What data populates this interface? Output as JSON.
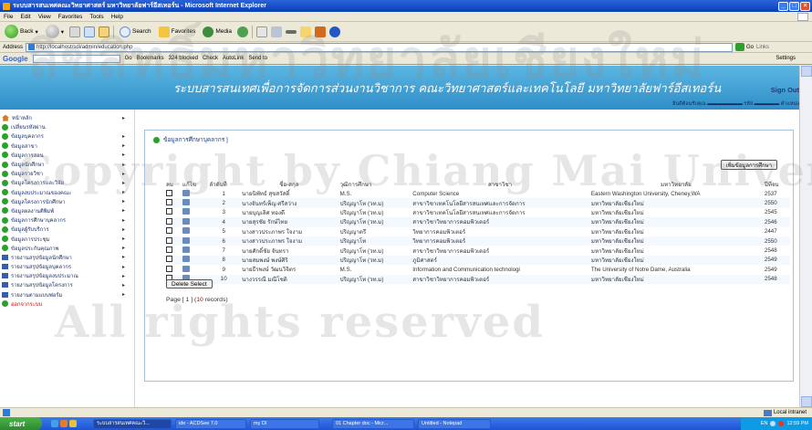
{
  "window": {
    "title": "ระบบสารสนเทศคณะวิทยาศาสตร์ มหาวิทยาลัยฟาร์อีสเทอร์น - Microsoft Internet Explorer"
  },
  "menu": [
    "File",
    "Edit",
    "View",
    "Favorites",
    "Tools",
    "Help"
  ],
  "toolbar": {
    "back": "Back",
    "search": "Search",
    "favorites": "Favorites",
    "media": "Media"
  },
  "address": {
    "label": "Address",
    "url": "http://localhost/sdi/admin/education.php",
    "go": "Go",
    "links": "Links"
  },
  "googlebar": {
    "logo": "Google",
    "go": "Go",
    "bookmarks": "Bookmarks",
    "blocked": "324 blocked",
    "check": "Check",
    "autolink": "AutoLink",
    "sendto": "Send to",
    "settings": "Settings"
  },
  "banner": {
    "title": "ระบบสารสนเทศเพื่อการจัดการส่วนงานวิชาการ คณะวิทยาศาสตร์และเทคโนโลยี มหาวิทยาลัยฟาร์อีสเทอร์น",
    "signout": "Sign Out"
  },
  "sidebar": {
    "items": [
      {
        "label": "หน้าหลัก",
        "icon": "home-icon",
        "arrow": "▸"
      },
      {
        "label": "เปลี่ยนรหัสผ่าน",
        "icon": "bullet-icon",
        "arrow": ""
      },
      {
        "label": "ข้อมูลบุคลากร",
        "icon": "bullet-icon",
        "arrow": "▸"
      },
      {
        "label": "ข้อมูลสาขา",
        "icon": "bullet-icon",
        "arrow": "▸"
      },
      {
        "label": "ข้อมูลการสอน",
        "icon": "bullet-icon",
        "arrow": "▸"
      },
      {
        "label": "ข้อมูลนักศึกษา",
        "icon": "bullet-icon",
        "arrow": "▸"
      },
      {
        "label": "ข้อมูลรายวิชา",
        "icon": "bullet-icon",
        "arrow": "▸"
      },
      {
        "label": "ข้อมูลโครงการและวิจัย",
        "icon": "bullet-icon",
        "arrow": "▸"
      },
      {
        "label": "ข้อมูลงบประมาณของคณะ",
        "icon": "bullet-icon",
        "arrow": "▸"
      },
      {
        "label": "ข้อมูลโครงการนักศึกษา",
        "icon": "bullet-icon",
        "arrow": "▸"
      },
      {
        "label": "ข้อมูลผลงานตีพิมพ์",
        "icon": "bullet-icon",
        "arrow": "▸"
      },
      {
        "label": "ข้อมูลการศึกษาบุคลากร",
        "icon": "bullet-icon",
        "arrow": "▸"
      },
      {
        "label": "ข้อมูลผู้รับบริการ",
        "icon": "bullet-icon",
        "arrow": "▸"
      },
      {
        "label": "ข้อมูลการประชุม",
        "icon": "bullet-icon",
        "arrow": "▸"
      },
      {
        "label": "ข้อมูลประกันคุณภาพ",
        "icon": "bullet-icon",
        "arrow": "▸"
      },
      {
        "label": "รายงานสรุปข้อมูลนักศึกษา",
        "icon": "book-icon",
        "arrow": "▸"
      },
      {
        "label": "รายงานสรุปข้อมูลบุคลากร",
        "icon": "book-icon",
        "arrow": "▸"
      },
      {
        "label": "รายงานสรุปข้อมูลงบประมาณ",
        "icon": "book-icon",
        "arrow": "▸"
      },
      {
        "label": "รายงานสรุปข้อมูลโครงการ",
        "icon": "book-icon",
        "arrow": "▸"
      },
      {
        "label": "รายงานตามแบบฟอร์ม",
        "icon": "book-icon",
        "arrow": "▸"
      },
      {
        "label": "ออกจากระบบ",
        "icon": "bullet-icon",
        "arrow": "",
        "red": true
      }
    ]
  },
  "panel": {
    "title": "ข้อมูลการศึกษาบุคลากร ]",
    "add_button": "เพิ่มข้อมูลการศึกษา",
    "delete_button": "Delete Select",
    "pager_prefix": "Page [ 1 ] (",
    "record_count": "10",
    "pager_suffix": " records)"
  },
  "table": {
    "headers": [
      "ลบ",
      "แก้ไข",
      "ลำดับที่",
      "ชื่อ-สกุล",
      "วุฒิการศึกษา",
      "สาขาวิชา",
      "มหาวิทยาลัย",
      "ปีที่จบ"
    ],
    "rows": [
      [
        "1",
        "นายนิพัทธ์ สุขสวัสดิ์",
        "M.S.",
        "Computer Science",
        "Eastern Washington University, Cheney,WA",
        "2537"
      ],
      [
        "2",
        "นางจันทร์เพ็ญ ศรีสว่าง",
        "ปริญญาโท (วท.ม)",
        "สาขาวิชาเทคโนโลยีสารสนเทศและการจัดการ",
        "มหาวิทยาลัยเชียงใหม่",
        "2550"
      ],
      [
        "3",
        "นายบุญเลิศ ทองดี",
        "ปริญญาโท (วท.ม)",
        "สาขาวิชาเทคโนโลยีสารสนเทศและการจัดการ",
        "มหาวิทยาลัยเชียงใหม่",
        "2545"
      ],
      [
        "4",
        "นายสุรชัย รักษ์ไทย",
        "ปริญญาโท (วท.ม)",
        "สาขาวิชาวิทยาการคอมพิวเตอร์",
        "มหาวิทยาลัยเชียงใหม่",
        "2546"
      ],
      [
        "5",
        "นางสาวประภาพร ใจงาม",
        "ปริญญาตรี",
        "วิทยาการคอมพิวเตอร์",
        "มหาวิทยาลัยเชียงใหม่",
        "2447"
      ],
      [
        "6",
        "นางสาวประภาพร ใจงาม",
        "ปริญญาโท",
        "วิทยาการคอมพิวเตอร์",
        "มหาวิทยาลัยเชียงใหม่",
        "2550"
      ],
      [
        "7",
        "นายศักดิ์ชัย จันทรา",
        "ปริญญาโท (วท.ม)",
        "สาขาวิชาวิทยาการคอมพิวเตอร์",
        "มหาวิทยาลัยเชียงใหม่",
        "2548"
      ],
      [
        "8",
        "นายสมพงษ์ พงษ์ศิริ",
        "ปริญญาโท (วท.ม)",
        "ภูมิศาสตร์",
        "มหาวิทยาลัยเชียงใหม่",
        "2549"
      ],
      [
        "9",
        "นายธีรพงษ์ วัฒนวิจิตร",
        "M.S.",
        "Information and Communication technologi",
        "The University of Notre Dame, Australia",
        "2549"
      ],
      [
        "10",
        "นางวรรณี มณีโชติ",
        "ปริญญาโท (วท.ม)",
        "สาขาวิชาวิทยาการคอมพิวเตอร์",
        "มหาวิทยาลัยเชียงใหม่",
        "2548"
      ]
    ]
  },
  "statusbar": {
    "zone": "Local intranet"
  },
  "taskbar": {
    "start": "start",
    "tasks": [
      "ระบบสารสนเทศคณะวิ...",
      "ide - ACDSee 7.0",
      "my DI",
      "01 Chapter doc - Micr...",
      "Untitled - Notepad"
    ],
    "lang": "EN",
    "clock": "12:59 PM"
  },
  "watermark": [
    "ลิขสิทธิ์มหาวิทยาลัยเชียงใหม่",
    "Copyright by Chiang Mai University",
    "All rights reserved"
  ]
}
